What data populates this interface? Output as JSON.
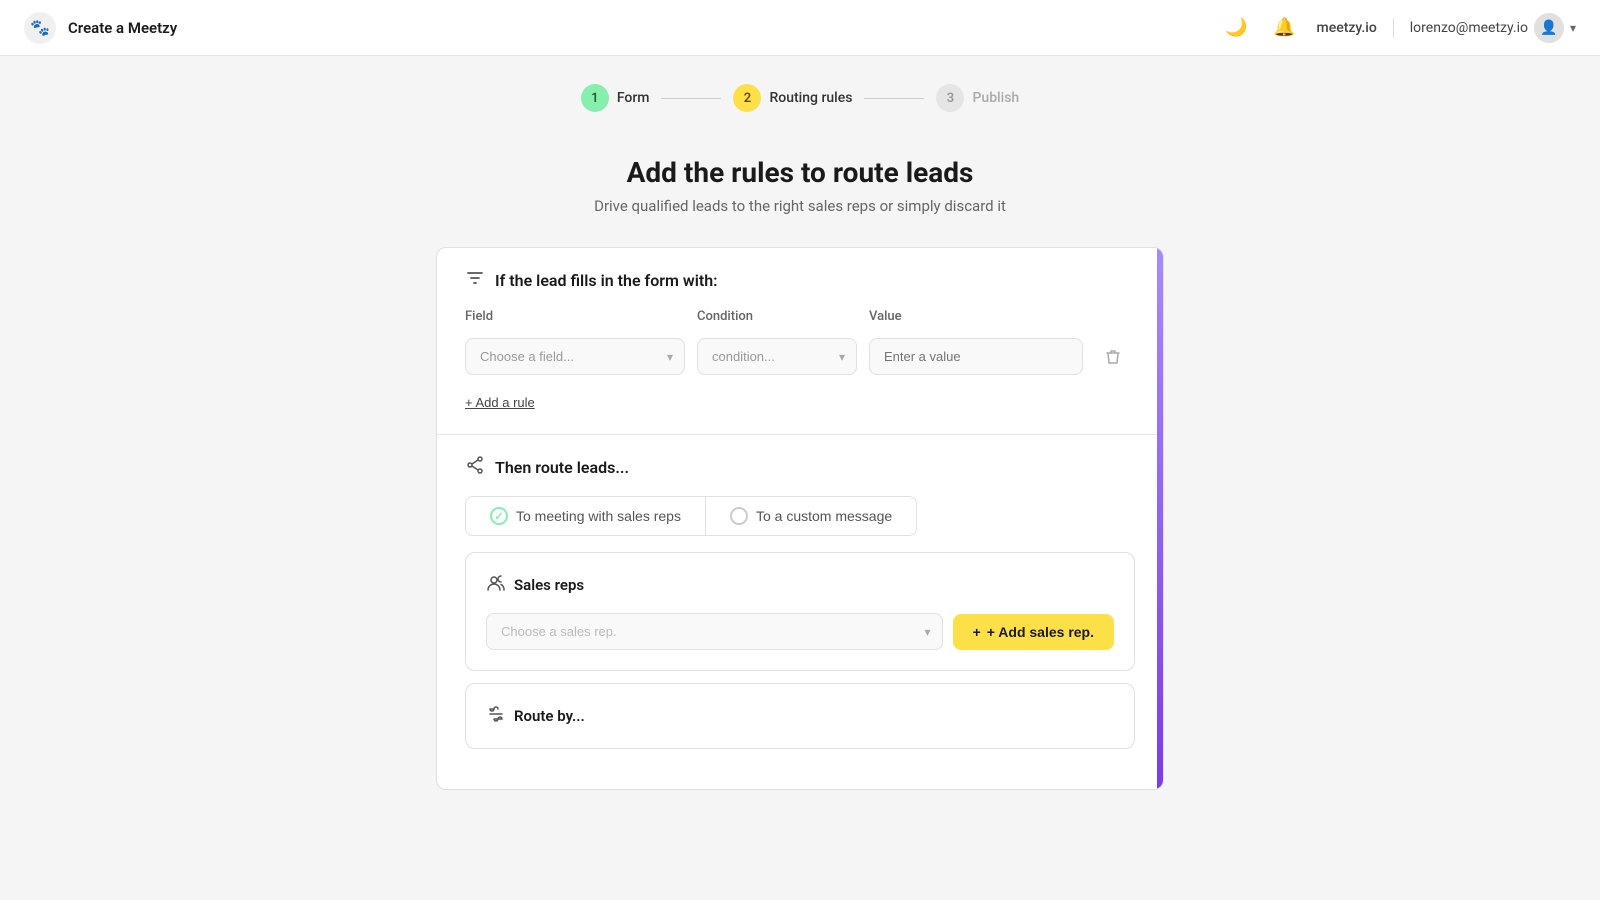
{
  "header": {
    "logo_emoji": "🐾",
    "title": "Create a Meetzy",
    "domain": "meetzy.io",
    "user_email": "lorenzo@meetzy.io",
    "moon_icon": "🌙",
    "bell_icon": "🔔"
  },
  "stepper": {
    "steps": [
      {
        "number": "1",
        "label": "Form",
        "state": "done"
      },
      {
        "number": "2",
        "label": "Routing rules",
        "state": "active"
      },
      {
        "number": "3",
        "label": "Publish",
        "state": "inactive"
      }
    ]
  },
  "page": {
    "heading": "Add the rules to route leads",
    "subheading": "Drive qualified leads to the right sales reps or simply discard it"
  },
  "filter_section": {
    "title": "If the lead fills in the form with:",
    "field_label": "Field",
    "condition_label": "Condition",
    "value_label": "Value",
    "field_placeholder": "Choose a field...",
    "condition_placeholder": "condition...",
    "value_placeholder": "Enter a value",
    "add_rule_label": "+ Add a rule"
  },
  "route_section": {
    "title": "Then route leads...",
    "option_meeting": "To meeting with sales reps",
    "option_message": "To a custom message"
  },
  "sales_reps": {
    "title": "Sales reps",
    "select_placeholder": "Choose a sales rep.",
    "add_button": "+ Add sales rep."
  },
  "route_by": {
    "title": "Route by..."
  }
}
